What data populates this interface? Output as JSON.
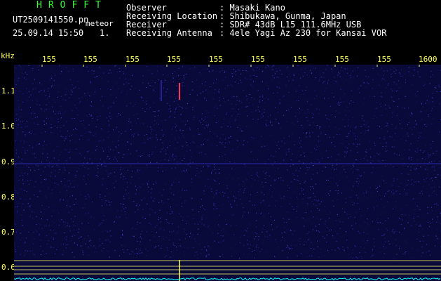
{
  "header": {
    "app_title": "HROFFT",
    "file_name": "UT2509141550.pn",
    "file_suffix": "meteor",
    "datetime": "25.09.14 15:50",
    "count": "1."
  },
  "info": {
    "observer_label": "Observer",
    "observer_value": ": Masaki Kano",
    "location_label": "Receiving Location",
    "location_value": ": Shibukawa, Gunma, Japan",
    "receiver_label": "Receiver",
    "receiver_value": ": SDR# 43dB L15 111.6MHz USB",
    "antenna_label": "Receiving Antenna",
    "antenna_value": ": 4ele Yagi Az 230 for Kansai VOR"
  },
  "axes": {
    "y_unit": "kHz",
    "y_ticks": [
      "1.1",
      "1.0",
      "0.9",
      "0.8",
      "0.7",
      "0.6"
    ],
    "x_ticks": [
      "155",
      "155",
      "155",
      "155",
      "155",
      "155",
      "155",
      "155",
      "155",
      "1600"
    ]
  },
  "colors": {
    "background": "#000000",
    "title": "#33ff33",
    "axis_text": "#ffff66",
    "plot_bg": "#0a0a3a",
    "noise": "#2a2ab0",
    "marker_line": "#ffff66",
    "baseline": "#00ffff",
    "echo_red": "#ff3355"
  }
}
